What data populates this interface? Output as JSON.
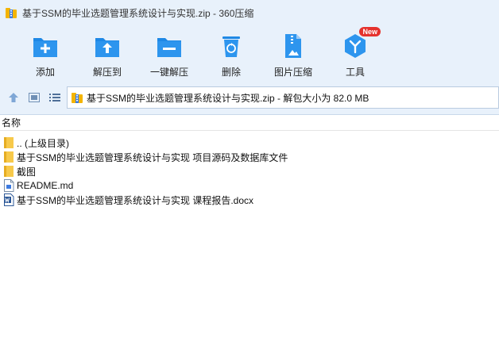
{
  "window": {
    "title": "基于SSM的毕业选题管理系统设计与实现.zip - 360压缩"
  },
  "toolbar": {
    "buttons": [
      {
        "label": "添加",
        "icon": "add-folder-icon"
      },
      {
        "label": "解压到",
        "icon": "extract-folder-icon"
      },
      {
        "label": "一键解压",
        "icon": "quick-extract-folder-icon"
      },
      {
        "label": "删除",
        "icon": "recycle-bin-icon"
      },
      {
        "label": "图片压缩",
        "icon": "image-compress-zip-icon"
      },
      {
        "label": "工具",
        "icon": "tools-cube-icon",
        "badge": "New"
      }
    ]
  },
  "addressbar": {
    "path_text": "基于SSM的毕业选题管理系统设计与实现.zip - 解包大小为 82.0 MB"
  },
  "filelist": {
    "header": "名称",
    "items": [
      {
        "name": ".. (上级目录)",
        "type": "folder"
      },
      {
        "name": "基于SSM的毕业选题管理系统设计与实现 项目源码及数据库文件",
        "type": "folder"
      },
      {
        "name": "截图",
        "type": "folder"
      },
      {
        "name": "README.md",
        "type": "file"
      },
      {
        "name": "基于SSM的毕业选题管理系统设计与实现 课程报告.docx",
        "type": "word"
      }
    ]
  },
  "colors": {
    "accent": "#1e88e5",
    "chrome_bg": "#e8f1fb",
    "badge": "#e5322d"
  }
}
